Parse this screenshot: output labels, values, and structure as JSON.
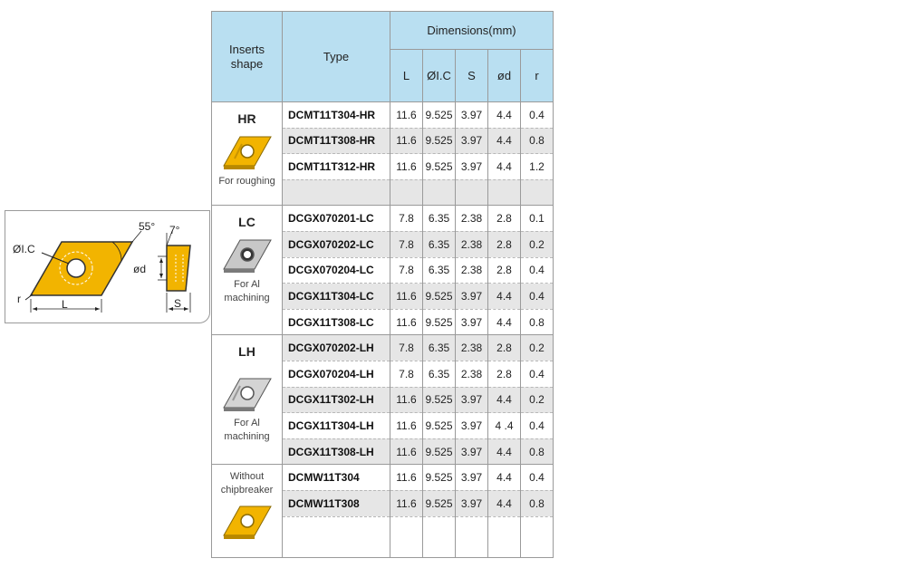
{
  "diagram": {
    "angle_tip": "55°",
    "angle_side": "7°",
    "label_ic": "ØI.C",
    "label_d": "ød",
    "label_r": "r",
    "label_l": "L",
    "label_s": "S"
  },
  "table": {
    "header": {
      "inserts_shape": "Inserts\nshape",
      "type": "Type",
      "dimensions": "Dimensions(mm)",
      "cols": [
        "L",
        "ØI.C",
        "S",
        "ød",
        "r"
      ]
    },
    "groups": [
      {
        "name": "HR",
        "desc": "For roughing",
        "rows": [
          {
            "type": "DCMT11T304-HR",
            "vals": [
              "11.6",
              "9.525",
              "3.97",
              "4.4",
              "0.4"
            ]
          },
          {
            "type": "DCMT11T308-HR",
            "vals": [
              "11.6",
              "9.525",
              "3.97",
              "4.4",
              "0.8"
            ]
          },
          {
            "type": "DCMT11T312-HR",
            "vals": [
              "11.6",
              "9.525",
              "3.97",
              "4.4",
              "1.2"
            ]
          },
          {
            "type": "",
            "vals": [
              "",
              "",
              "",
              "",
              ""
            ]
          }
        ]
      },
      {
        "name": "LC",
        "desc": "For Al\nmachining",
        "rows": [
          {
            "type": "DCGX070201-LC",
            "vals": [
              "7.8",
              "6.35",
              "2.38",
              "2.8",
              "0.1"
            ]
          },
          {
            "type": "DCGX070202-LC",
            "vals": [
              "7.8",
              "6.35",
              "2.38",
              "2.8",
              "0.2"
            ]
          },
          {
            "type": "DCGX070204-LC",
            "vals": [
              "7.8",
              "6.35",
              "2.38",
              "2.8",
              "0.4"
            ]
          },
          {
            "type": "DCGX11T304-LC",
            "vals": [
              "11.6",
              "9.525",
              "3.97",
              "4.4",
              "0.4"
            ]
          },
          {
            "type": "DCGX11T308-LC",
            "vals": [
              "11.6",
              "9.525",
              "3.97",
              "4.4",
              "0.8"
            ]
          }
        ]
      },
      {
        "name": "LH",
        "desc": "For Al\nmachining",
        "rows": [
          {
            "type": "DCGX070202-LH",
            "vals": [
              "7.8",
              "6.35",
              "2.38",
              "2.8",
              "0.2"
            ]
          },
          {
            "type": "DCGX070204-LH",
            "vals": [
              "7.8",
              "6.35",
              "2.38",
              "2.8",
              "0.4"
            ]
          },
          {
            "type": "DCGX11T302-LH",
            "vals": [
              "11.6",
              "9.525",
              "3.97",
              "4.4",
              "0.2"
            ]
          },
          {
            "type": "DCGX11T304-LH",
            "vals": [
              "11.6",
              "9.525",
              "3.97",
              "4 .4",
              "0.4"
            ]
          },
          {
            "type": "DCGX11T308-LH",
            "vals": [
              "11.6",
              "9.525",
              "3.97",
              "4.4",
              "0.8"
            ]
          }
        ]
      },
      {
        "name": "",
        "desc": "Without\nchipbreaker",
        "rows": [
          {
            "type": "DCMW11T304",
            "vals": [
              "11.6",
              "9.525",
              "3.97",
              "4.4",
              "0.4"
            ]
          },
          {
            "type": "DCMW11T308",
            "vals": [
              "11.6",
              "9.525",
              "3.97",
              "4.4",
              "0.8"
            ]
          },
          {
            "type": "",
            "vals": [
              "",
              "",
              "",
              "",
              ""
            ]
          }
        ]
      }
    ]
  },
  "colors": {
    "header_bg": "#b9dff1",
    "shade_row": "#e6e6e6",
    "insert_gold": "#f2b400",
    "insert_silver": "#9a9a9a"
  }
}
